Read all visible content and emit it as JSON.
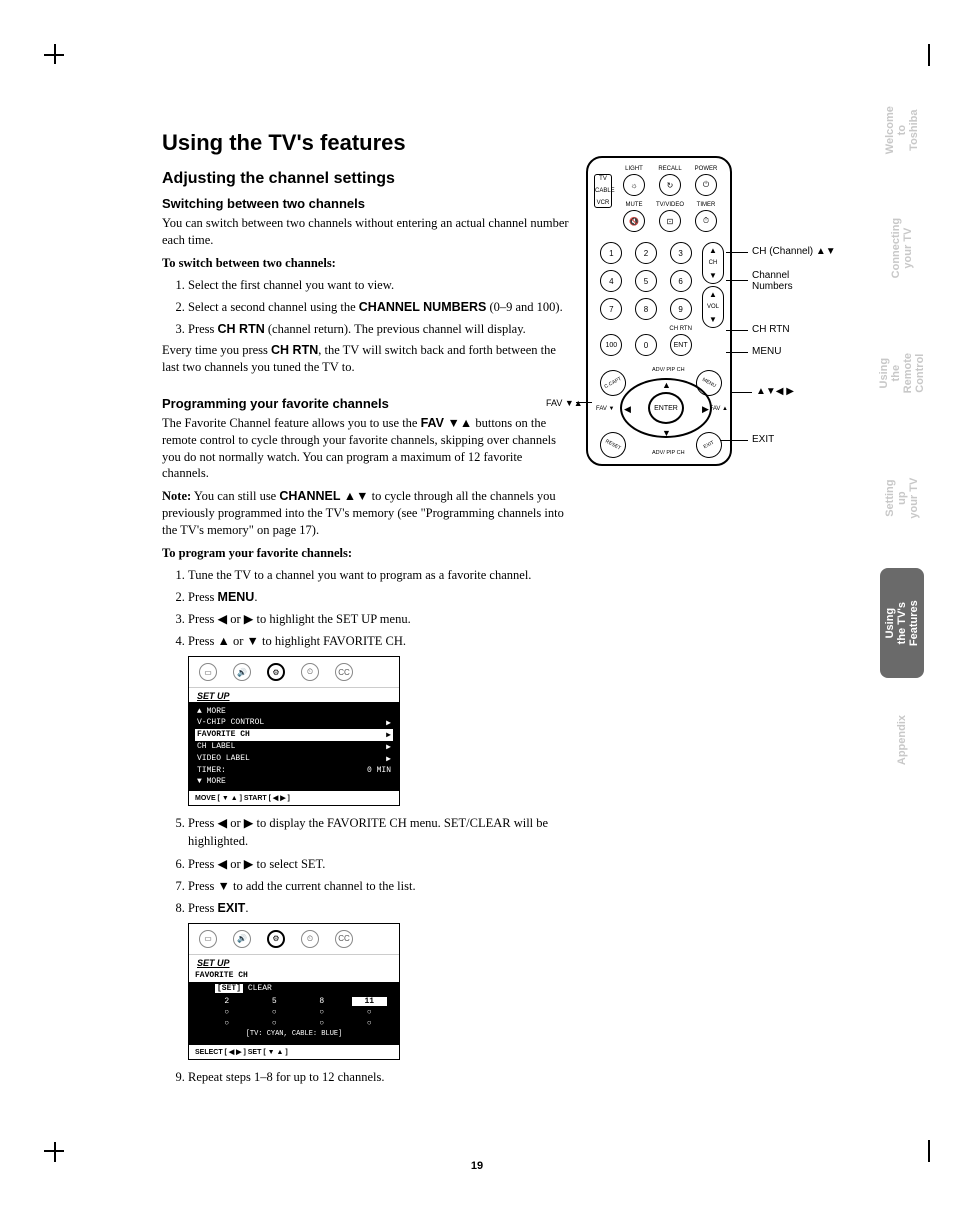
{
  "headings": {
    "h1": "Using the TV's features",
    "h2": "Adjusting the channel settings",
    "h3a": "Switching between two channels",
    "h3b": "Programming your favorite channels"
  },
  "switch": {
    "p1": "You can switch between two channels without entering an actual channel number each time.",
    "lead": "To switch between two channels:",
    "s1": "Select the first channel you want to view.",
    "s2a": "Select a second channel using the ",
    "s2b": "CHANNEL NUMBERS",
    "s2c": " (0–9 and 100).",
    "s3a": "Press ",
    "s3b": "CH RTN",
    "s3c": " (channel return). The previous channel will display.",
    "tail_a": "Every time you press ",
    "tail_b": "CH RTN",
    "tail_c": ", the TV will switch back and forth between the last two channels you tuned the TV to."
  },
  "fav": {
    "p1a": "The Favorite Channel feature allows you to use the ",
    "p1b": "FAV ▼▲",
    "p1c": " buttons on the remote control to cycle through your favorite channels, skipping over channels you do not normally watch. You can program a maximum of 12 favorite channels.",
    "note_a": "Note:",
    "note_b": " You can still use ",
    "note_c": "CHANNEL ▲▼",
    "note_d": " to cycle through all the channels you previously programmed into the TV's memory (see \"Programming channels into the TV's memory\" on page 17).",
    "lead": "To program your favorite channels:",
    "s1": "Tune the TV to a channel you want to program as a favorite channel.",
    "s2a": "Press ",
    "s2b": "MENU",
    "s2c": ".",
    "s3": "Press ◀ or ▶ to highlight the SET UP menu.",
    "s4": "Press ▲ or ▼ to highlight FAVORITE CH.",
    "s5": "Press ◀ or ▶ to display the FAVORITE CH menu. SET/CLEAR will be highlighted.",
    "s6": "Press ◀ or ▶ to select SET.",
    "s7": "Press ▼ to add the current channel to the list.",
    "s8a": "Press ",
    "s8b": "EXIT",
    "s8c": ".",
    "s9": "Repeat steps 1–8 for up to 12 channels."
  },
  "osd1": {
    "title": "SET UP",
    "r_more1": "▲ MORE",
    "r_vchip": "V-CHIP CONTROL",
    "r_vchip_v": "▶",
    "r_fav": "FAVORITE CH",
    "r_fav_v": "▶",
    "r_chl": "CH LABEL",
    "r_chl_v": "▶",
    "r_vid": "VIDEO LABEL",
    "r_vid_v": "▶",
    "r_tim": "TIMER:",
    "r_tim_v": "0 MIN",
    "r_more2": "▼ MORE",
    "foot": "MOVE [ ▼ ▲ ]    START [ ◀  ▶ ]"
  },
  "osd2": {
    "title": "SET UP",
    "sub": "FAVORITE CH",
    "setclear_a": "[SET]",
    "setclear_b": " CLEAR",
    "grid": [
      "2",
      "5",
      "8",
      "11",
      "○",
      "○",
      "○",
      "○",
      "○",
      "○",
      "○",
      "○"
    ],
    "note": "[TV: CYAN,  CABLE: BLUE]",
    "foot": "SELECT [ ◀  ▶ ]    SET [ ▼  ▲ ]"
  },
  "remote": {
    "top_labels": [
      "LIGHT",
      "RECALL",
      "POWER"
    ],
    "row2_labels": [
      "MUTE",
      "TV/VIDEO",
      "TIMER"
    ],
    "switch": [
      "TV",
      "CABLE",
      "VCR"
    ],
    "nums": [
      "1",
      "2",
      "3",
      "4",
      "5",
      "6",
      "7",
      "8",
      "9",
      "100",
      "0",
      "ENT"
    ],
    "ch": "CH",
    "vol": "VOL",
    "chrtn": "CH RTN",
    "enter": "ENTER",
    "corners": [
      "C.CAPT",
      "MENU",
      "RESET",
      "EXIT"
    ],
    "pip": "ADV/\nPIP CH",
    "fav_l": "FAV ▼",
    "fav_r": "FAV ▲"
  },
  "callouts": {
    "ch": "CH (Channel) ▲▼",
    "nums": "Channel\nNumbers",
    "chrtn": "CH RTN",
    "menu": "MENU",
    "arrows": "▲▼◀ ▶",
    "exit": "EXIT",
    "fav_left": "FAV ▼▲"
  },
  "tabs": {
    "t1": "Welcome to\nToshiba",
    "t2": "Connecting\nyour TV",
    "t3": "Using the\nRemote Control",
    "t4": "Setting up\nyour TV",
    "t5": "Using the TV's\nFeatures",
    "t6": "Appendix"
  },
  "page_num": "19"
}
